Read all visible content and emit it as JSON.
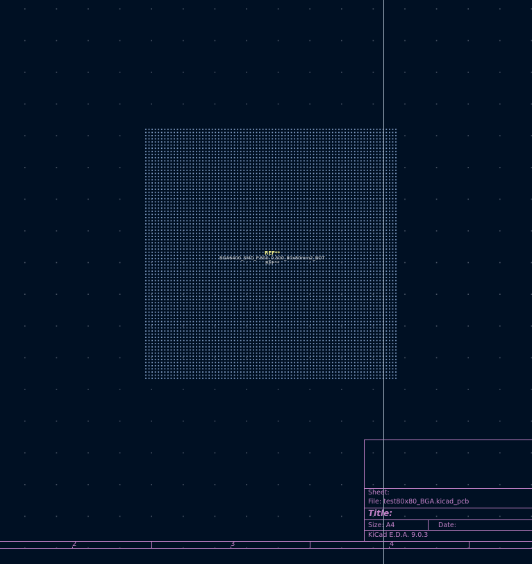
{
  "app": "KiCad PCB Editor",
  "colors": {
    "background": "#001023",
    "grid_dot": "#4a5566",
    "pad": "#7f9cc4",
    "cursor": "#9aa8b8",
    "worksheet": "#c281c7",
    "reference": "#f3f08a",
    "value": "#e8e8e8"
  },
  "footprint": {
    "reference_top": "REF**",
    "value": "BGA6400_SMD_P.800_0.500_80x80mm2_BOT",
    "reference_bottom": "REF**",
    "ball_grid_columns": 80,
    "ball_grid_rows": 80
  },
  "title_block": {
    "sheet_label": "Sheet:",
    "file_label": "File:",
    "file_value": "test80x80_BGA.kicad_pcb",
    "title_label": "Title:",
    "size_label": "Size:",
    "size_value": "A4",
    "date_label": "Date:",
    "tool_label": "KiCad E.D.A.",
    "tool_version": "9.0.3"
  },
  "ruler": {
    "numbers": [
      "2",
      "3",
      "4"
    ]
  }
}
